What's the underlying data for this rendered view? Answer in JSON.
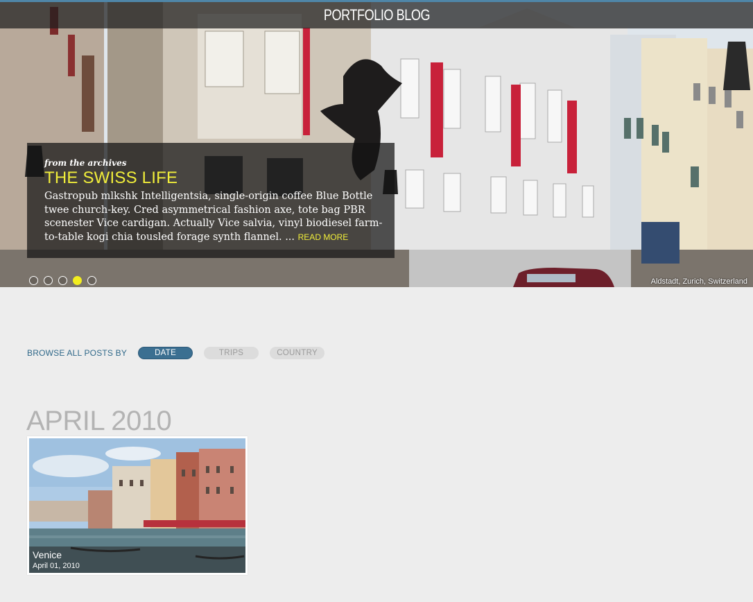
{
  "site": {
    "title": "PORTFOLIO BLOG"
  },
  "hero": {
    "kicker": "from the archives",
    "title": "THE SWISS LIFE",
    "excerpt": "Gastropub mlkshk Intelligentsia, single-origin coffee Blue Bottle twee church-key. Cred asymmetrical fashion axe, tote bag PBR scenester Vice cardigan. Actually Vice salvia, vinyl biodiesel farm-to-table kogi chia tousled forage synth flannel. ...",
    "read_more": "READ MORE",
    "caption": "Aldstadt, Zurich, Switzerland",
    "slides": 5,
    "active_slide": 4
  },
  "browse": {
    "label": "BROWSE ALL POSTS BY",
    "options": [
      {
        "label": "DATE",
        "active": true
      },
      {
        "label": "TRIPS",
        "active": false
      },
      {
        "label": "COUNTRY",
        "active": false
      }
    ]
  },
  "archive": {
    "month": "APRIL 2010",
    "posts": [
      {
        "title": "Venice",
        "date": "April 01, 2010"
      }
    ]
  },
  "colors": {
    "accent_yellow": "#f1ee3a",
    "brand_blue": "#3b6f91",
    "banner_red": "#c8213a",
    "page_bg": "#ededed"
  }
}
